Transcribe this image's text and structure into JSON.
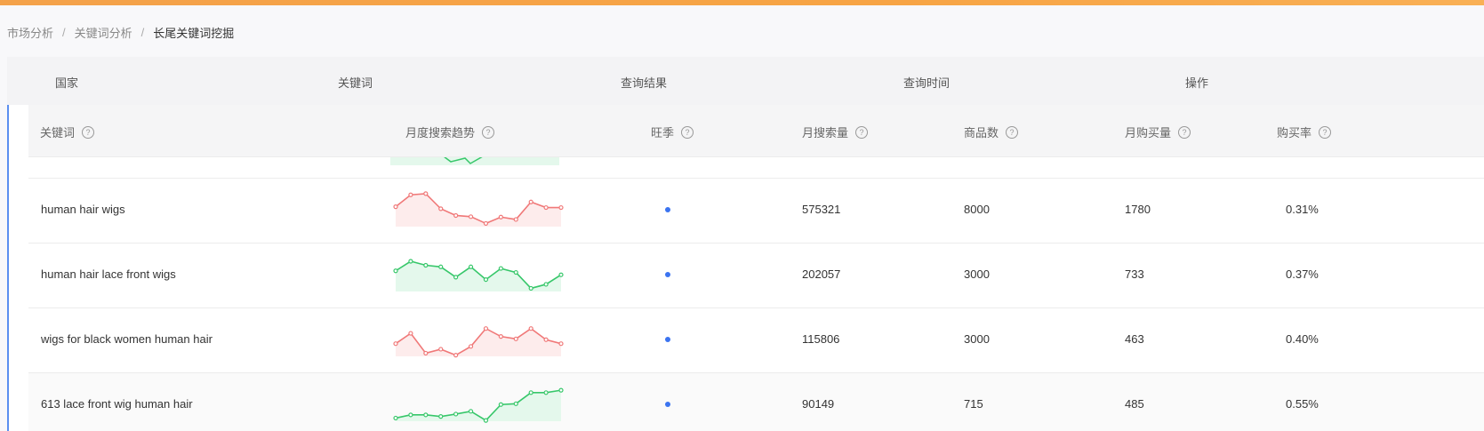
{
  "breadcrumb": {
    "items": [
      "市场分析",
      "关键词分析"
    ],
    "separator": "/",
    "current": "长尾关键词挖掘"
  },
  "query_header": {
    "columns": [
      "国家",
      "关键词",
      "查询结果",
      "查询时间",
      "操作"
    ]
  },
  "table": {
    "headers": {
      "keyword": "关键词",
      "trend": "月度搜索趋势",
      "peak": "旺季",
      "monthly_search": "月搜索量",
      "product_count": "商品数",
      "monthly_purchase": "月购买量",
      "purchase_rate": "购买率"
    },
    "help_glyph": "?",
    "rows": [
      {
        "keyword": "human hair wigs",
        "trend_color": "#f07878",
        "trend_fill": "#fdecec",
        "trend": [
          5,
          8,
          8.3,
          4.5,
          2.8,
          2.5,
          0.8,
          2.4,
          1.8,
          6.2,
          4.8,
          4.8
        ],
        "peak_dot_color": "#3b74f0",
        "monthly_search": "575321",
        "product_count": "8000",
        "monthly_purchase": "1780",
        "purchase_rate": "0.31%"
      },
      {
        "keyword": "human hair lace front wigs",
        "trend_color": "#37c76a",
        "trend_fill": "#e4f8ec",
        "trend": [
          5.2,
          7.6,
          6.6,
          6.2,
          3.6,
          6.2,
          3.0,
          5.8,
          4.8,
          0.8,
          1.8,
          4.2
        ],
        "peak_dot_color": "#3b74f0",
        "monthly_search": "202057",
        "product_count": "3000",
        "monthly_purchase": "733",
        "purchase_rate": "0.37%"
      },
      {
        "keyword": "wigs for black women human hair",
        "trend_color": "#f07878",
        "trend_fill": "#fdecec",
        "trend": [
          3.2,
          5.8,
          0.8,
          1.8,
          0.3,
          2.5,
          7.0,
          5.0,
          4.4,
          7.0,
          4.2,
          3.2
        ],
        "peak_dot_color": "#3b74f0",
        "monthly_search": "115806",
        "product_count": "3000",
        "monthly_purchase": "463",
        "purchase_rate": "0.40%"
      },
      {
        "keyword": "613 lace front wig human hair",
        "trend_color": "#37c76a",
        "trend_fill": "#e4f8ec",
        "trend": [
          0.8,
          1.6,
          1.6,
          1.2,
          1.8,
          2.5,
          0.2,
          4.2,
          4.4,
          7.2,
          7.2,
          7.8
        ],
        "peak_dot_color": "#3b74f0",
        "monthly_search": "90149",
        "product_count": "715",
        "monthly_purchase": "485",
        "purchase_rate": "0.55%"
      }
    ]
  }
}
